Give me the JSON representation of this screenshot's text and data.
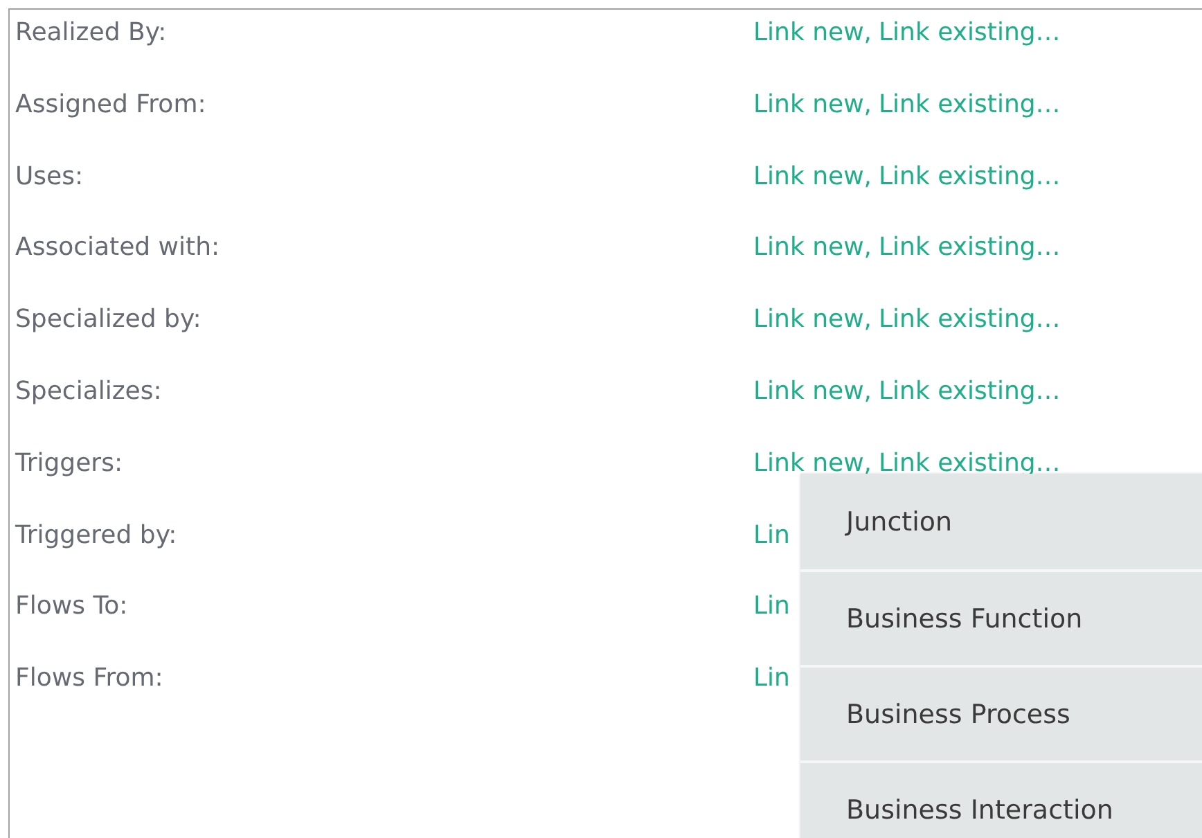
{
  "relations": [
    {
      "label": "Realized By:",
      "links": [
        "Link new",
        "Link existing…"
      ],
      "separator": ","
    },
    {
      "label": "Assigned From:",
      "links": [
        "Link new",
        "Link existing…"
      ],
      "separator": ","
    },
    {
      "label": "Uses:",
      "links": [
        "Link new",
        "Link existing…"
      ],
      "separator": ","
    },
    {
      "label": "Associated with:",
      "links": [
        "Link new",
        "Link existing…"
      ],
      "separator": ","
    },
    {
      "label": "Specialized by:",
      "links": [
        "Link new",
        "Link existing…"
      ],
      "separator": ","
    },
    {
      "label": "Specializes:",
      "links": [
        "Link new",
        "Link existing…"
      ],
      "separator": ","
    },
    {
      "label": "Triggers:",
      "links": [
        "Link new",
        "Link existing…"
      ],
      "separator": ","
    },
    {
      "label": "Triggered by:",
      "links": [
        "Lin"
      ]
    },
    {
      "label": "Flows To:",
      "links": [
        "Lin"
      ]
    },
    {
      "label": "Flows From:",
      "links": [
        "Lin"
      ]
    }
  ],
  "menu": {
    "items": [
      "Junction",
      "Business Function",
      "Business Process",
      "Business Interaction"
    ]
  }
}
